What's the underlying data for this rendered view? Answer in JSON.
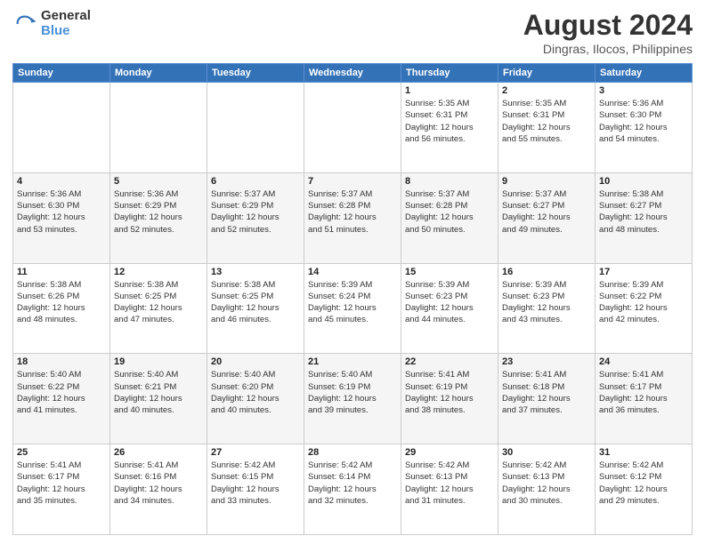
{
  "logo": {
    "general": "General",
    "blue": "Blue"
  },
  "title": "August 2024",
  "location": "Dingras, Ilocos, Philippines",
  "weekdays": [
    "Sunday",
    "Monday",
    "Tuesday",
    "Wednesday",
    "Thursday",
    "Friday",
    "Saturday"
  ],
  "weeks": [
    [
      {
        "day": "",
        "info": ""
      },
      {
        "day": "",
        "info": ""
      },
      {
        "day": "",
        "info": ""
      },
      {
        "day": "",
        "info": ""
      },
      {
        "day": "1",
        "info": "Sunrise: 5:35 AM\nSunset: 6:31 PM\nDaylight: 12 hours\nand 56 minutes."
      },
      {
        "day": "2",
        "info": "Sunrise: 5:35 AM\nSunset: 6:31 PM\nDaylight: 12 hours\nand 55 minutes."
      },
      {
        "day": "3",
        "info": "Sunrise: 5:36 AM\nSunset: 6:30 PM\nDaylight: 12 hours\nand 54 minutes."
      }
    ],
    [
      {
        "day": "4",
        "info": "Sunrise: 5:36 AM\nSunset: 6:30 PM\nDaylight: 12 hours\nand 53 minutes."
      },
      {
        "day": "5",
        "info": "Sunrise: 5:36 AM\nSunset: 6:29 PM\nDaylight: 12 hours\nand 52 minutes."
      },
      {
        "day": "6",
        "info": "Sunrise: 5:37 AM\nSunset: 6:29 PM\nDaylight: 12 hours\nand 52 minutes."
      },
      {
        "day": "7",
        "info": "Sunrise: 5:37 AM\nSunset: 6:28 PM\nDaylight: 12 hours\nand 51 minutes."
      },
      {
        "day": "8",
        "info": "Sunrise: 5:37 AM\nSunset: 6:28 PM\nDaylight: 12 hours\nand 50 minutes."
      },
      {
        "day": "9",
        "info": "Sunrise: 5:37 AM\nSunset: 6:27 PM\nDaylight: 12 hours\nand 49 minutes."
      },
      {
        "day": "10",
        "info": "Sunrise: 5:38 AM\nSunset: 6:27 PM\nDaylight: 12 hours\nand 48 minutes."
      }
    ],
    [
      {
        "day": "11",
        "info": "Sunrise: 5:38 AM\nSunset: 6:26 PM\nDaylight: 12 hours\nand 48 minutes."
      },
      {
        "day": "12",
        "info": "Sunrise: 5:38 AM\nSunset: 6:25 PM\nDaylight: 12 hours\nand 47 minutes."
      },
      {
        "day": "13",
        "info": "Sunrise: 5:38 AM\nSunset: 6:25 PM\nDaylight: 12 hours\nand 46 minutes."
      },
      {
        "day": "14",
        "info": "Sunrise: 5:39 AM\nSunset: 6:24 PM\nDaylight: 12 hours\nand 45 minutes."
      },
      {
        "day": "15",
        "info": "Sunrise: 5:39 AM\nSunset: 6:23 PM\nDaylight: 12 hours\nand 44 minutes."
      },
      {
        "day": "16",
        "info": "Sunrise: 5:39 AM\nSunset: 6:23 PM\nDaylight: 12 hours\nand 43 minutes."
      },
      {
        "day": "17",
        "info": "Sunrise: 5:39 AM\nSunset: 6:22 PM\nDaylight: 12 hours\nand 42 minutes."
      }
    ],
    [
      {
        "day": "18",
        "info": "Sunrise: 5:40 AM\nSunset: 6:22 PM\nDaylight: 12 hours\nand 41 minutes."
      },
      {
        "day": "19",
        "info": "Sunrise: 5:40 AM\nSunset: 6:21 PM\nDaylight: 12 hours\nand 40 minutes."
      },
      {
        "day": "20",
        "info": "Sunrise: 5:40 AM\nSunset: 6:20 PM\nDaylight: 12 hours\nand 40 minutes."
      },
      {
        "day": "21",
        "info": "Sunrise: 5:40 AM\nSunset: 6:19 PM\nDaylight: 12 hours\nand 39 minutes."
      },
      {
        "day": "22",
        "info": "Sunrise: 5:41 AM\nSunset: 6:19 PM\nDaylight: 12 hours\nand 38 minutes."
      },
      {
        "day": "23",
        "info": "Sunrise: 5:41 AM\nSunset: 6:18 PM\nDaylight: 12 hours\nand 37 minutes."
      },
      {
        "day": "24",
        "info": "Sunrise: 5:41 AM\nSunset: 6:17 PM\nDaylight: 12 hours\nand 36 minutes."
      }
    ],
    [
      {
        "day": "25",
        "info": "Sunrise: 5:41 AM\nSunset: 6:17 PM\nDaylight: 12 hours\nand 35 minutes."
      },
      {
        "day": "26",
        "info": "Sunrise: 5:41 AM\nSunset: 6:16 PM\nDaylight: 12 hours\nand 34 minutes."
      },
      {
        "day": "27",
        "info": "Sunrise: 5:42 AM\nSunset: 6:15 PM\nDaylight: 12 hours\nand 33 minutes."
      },
      {
        "day": "28",
        "info": "Sunrise: 5:42 AM\nSunset: 6:14 PM\nDaylight: 12 hours\nand 32 minutes."
      },
      {
        "day": "29",
        "info": "Sunrise: 5:42 AM\nSunset: 6:13 PM\nDaylight: 12 hours\nand 31 minutes."
      },
      {
        "day": "30",
        "info": "Sunrise: 5:42 AM\nSunset: 6:13 PM\nDaylight: 12 hours\nand 30 minutes."
      },
      {
        "day": "31",
        "info": "Sunrise: 5:42 AM\nSunset: 6:12 PM\nDaylight: 12 hours\nand 29 minutes."
      }
    ]
  ]
}
